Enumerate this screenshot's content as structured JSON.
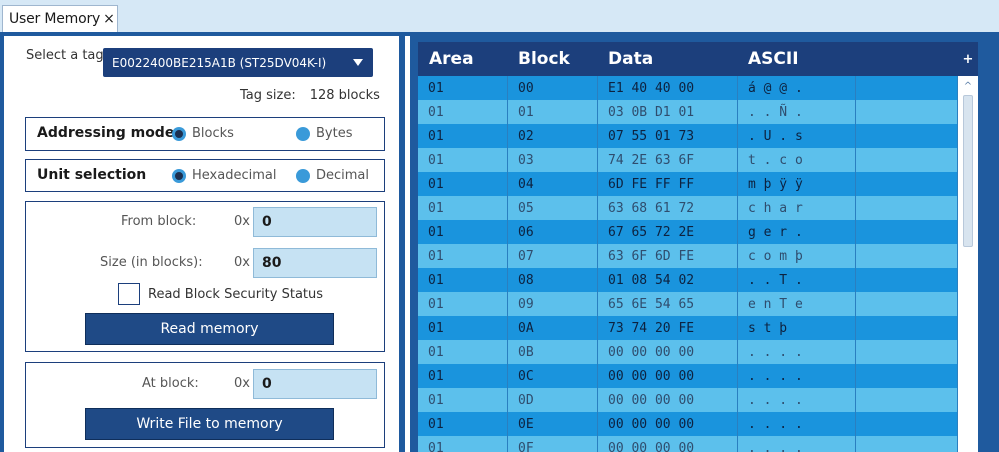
{
  "tab": {
    "label": "User Memory",
    "close": "×"
  },
  "tag": {
    "label": "Select a tag:",
    "selected": "E0022400BE215A1B (ST25DV04K-I)",
    "size_label": "Tag size:",
    "size_value": "128 blocks"
  },
  "addressing": {
    "title": "Addressing mode",
    "opt1": "Blocks",
    "opt2": "Bytes"
  },
  "unit": {
    "title": "Unit selection",
    "opt1": "Hexadecimal",
    "opt2": "Decimal"
  },
  "read": {
    "from_label": "From block:",
    "prefix": "0x",
    "from_value": "0",
    "size_label": "Size (in blocks):",
    "size_value": "80",
    "security_label": "Read Block Security Status",
    "button": "Read memory"
  },
  "write": {
    "at_label": "At block:",
    "prefix": "0x",
    "at_value": "0",
    "button": "Write File to memory"
  },
  "table": {
    "headers": [
      "Area",
      "Block",
      "Data",
      "ASCII"
    ],
    "rows": [
      [
        "01",
        "00",
        "E1 40 40 00",
        "á @ @ ."
      ],
      [
        "01",
        "01",
        "03 0B D1 01",
        ". . Ñ ."
      ],
      [
        "01",
        "02",
        "07 55 01 73",
        ". U . s"
      ],
      [
        "01",
        "03",
        "74 2E 63 6F",
        "t . c o"
      ],
      [
        "01",
        "04",
        "6D FE FF FF",
        "m þ ÿ ÿ"
      ],
      [
        "01",
        "05",
        "63 68 61 72",
        "c h a r"
      ],
      [
        "01",
        "06",
        "67 65 72 2E",
        "g e r ."
      ],
      [
        "01",
        "07",
        "63 6F 6D FE",
        "c o m þ"
      ],
      [
        "01",
        "08",
        "01 08 54 02",
        ". . T ."
      ],
      [
        "01",
        "09",
        "65 6E 54 65",
        "e n T e"
      ],
      [
        "01",
        "0A",
        "73 74 20 FE",
        "s t   þ"
      ],
      [
        "01",
        "0B",
        "00 00 00 00",
        ". . . ."
      ],
      [
        "01",
        "0C",
        "00 00 00 00",
        ". . . ."
      ],
      [
        "01",
        "0D",
        "00 00 00 00",
        ". . . ."
      ],
      [
        "01",
        "0E",
        "00 00 00 00",
        ". . . ."
      ],
      [
        "01",
        "0F",
        "00 00 00 00",
        ". . . ."
      ]
    ]
  },
  "toolbar": {
    "plus": "+",
    "scroll_up": "^"
  }
}
